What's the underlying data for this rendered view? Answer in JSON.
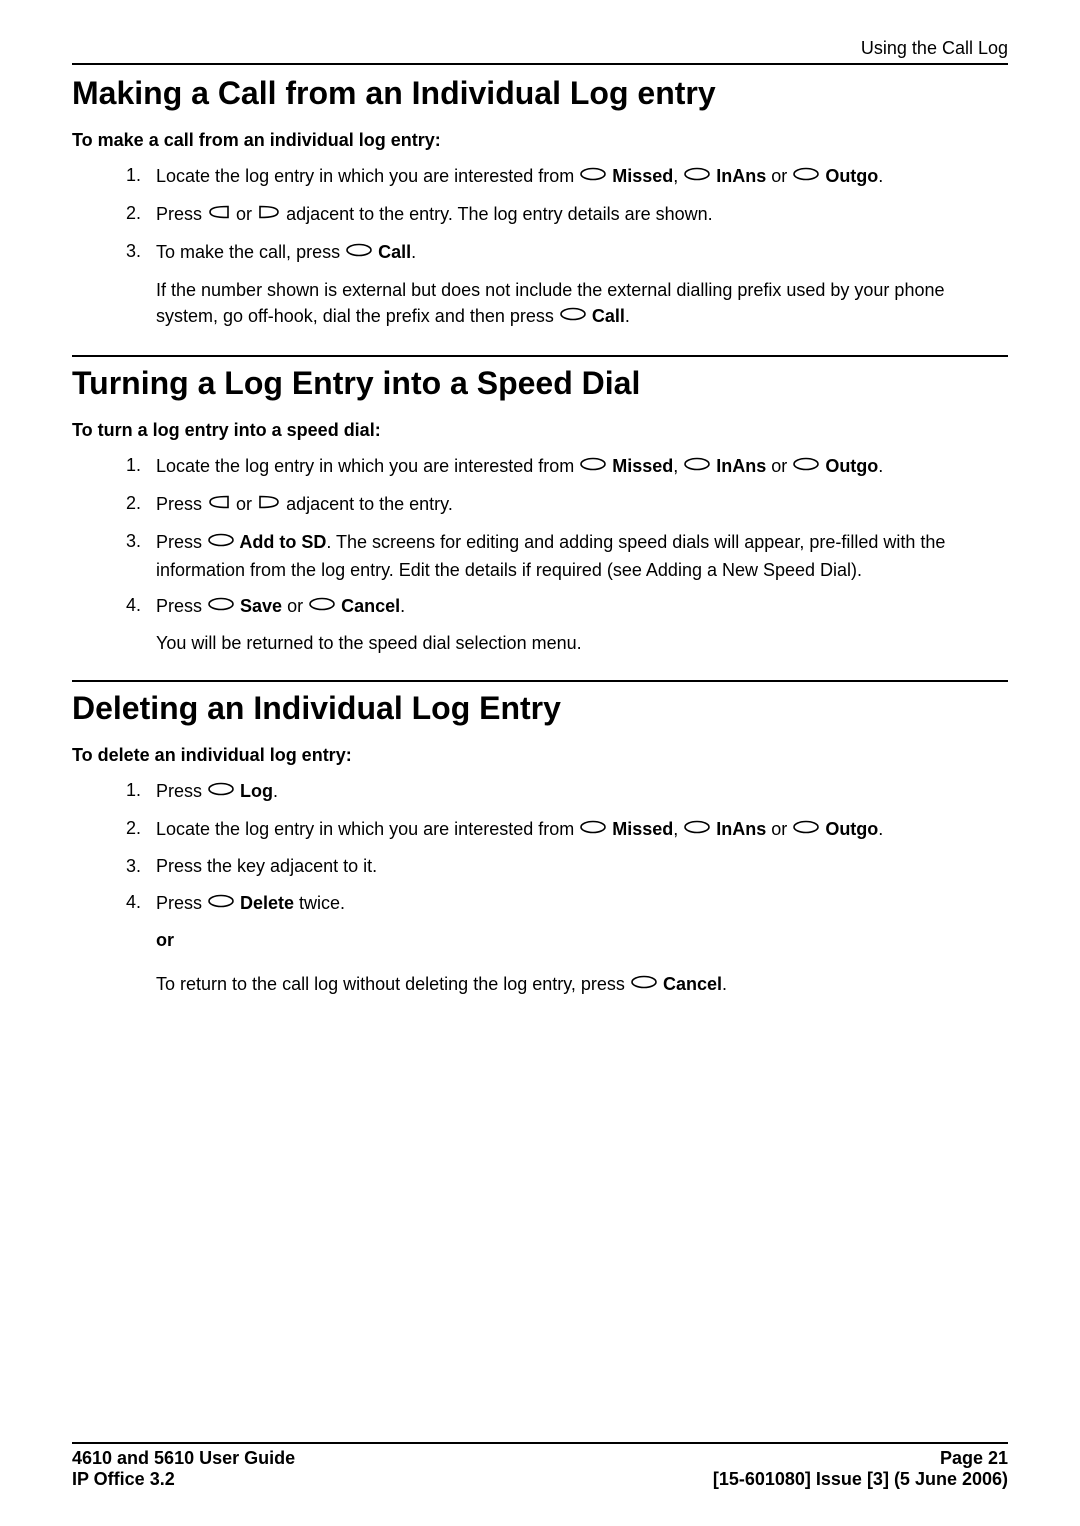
{
  "header": {
    "context": "Using the Call Log"
  },
  "section1": {
    "title": "Making a Call from an Individual Log entry",
    "intro": "To make a call from an individual log entry:",
    "step1_a": "Locate the log entry in which you are interested from ",
    "step1_b": " Missed",
    "step1_c": ", ",
    "step1_d": " InAns",
    "step1_e": " or ",
    "step1_f": " Outgo",
    "step1_g": ".",
    "step2_a": "Press ",
    "step2_b": " or ",
    "step2_c": " adjacent to the entry. The log entry details are shown.",
    "step3_a": "To make the call, press ",
    "step3_b": " Call",
    "step3_c": ".",
    "note_a": "If the number shown is external but does not include the external dialling prefix used by your phone system, go off-hook, dial the prefix and then press ",
    "note_b": " Call",
    "note_c": "."
  },
  "section2": {
    "title": "Turning a Log Entry into a Speed Dial",
    "intro": "To turn a log entry into a speed dial:",
    "step1_a": "Locate the log entry in which you are interested from ",
    "step1_b": " Missed",
    "step1_c": ", ",
    "step1_d": " InAns",
    "step1_e": " or ",
    "step1_f": " Outgo",
    "step1_g": ".",
    "step2_a": "Press ",
    "step2_b": " or ",
    "step2_c": " adjacent to the entry.",
    "step3_a": "Press ",
    "step3_b": " Add to SD",
    "step3_c": ". The screens for editing and adding speed dials will appear, pre-filled with the information from the log entry. Edit the details if required (see Adding a New Speed Dial).",
    "step4_a": "Press ",
    "step4_b": " Save",
    "step4_c": " or ",
    "step4_d": " Cancel",
    "step4_e": ".",
    "note": "You will be returned to the speed dial selection menu."
  },
  "section3": {
    "title": "Deleting an Individual Log Entry",
    "intro": "To delete an individual log entry:",
    "step1_a": "Press ",
    "step1_b": " Log",
    "step1_c": ".",
    "step2_a": "Locate the log entry in which you are interested from ",
    "step2_b": " Missed",
    "step2_c": ", ",
    "step2_d": " InAns",
    "step2_e": " or ",
    "step2_f": " Outgo",
    "step2_g": ".",
    "step3": "Press the key adjacent to it.",
    "step4_a": "Press ",
    "step4_b": " Delete",
    "step4_c": " twice.",
    "or": "or",
    "note_a": "To return to the call log without deleting the log entry, press ",
    "note_b": " Cancel",
    "note_c": "."
  },
  "footer": {
    "left1": "4610 and 5610 User Guide",
    "left2": "IP Office 3.2",
    "right1": "Page 21",
    "right2": "[15-601080] Issue [3] (5 June 2006)"
  }
}
